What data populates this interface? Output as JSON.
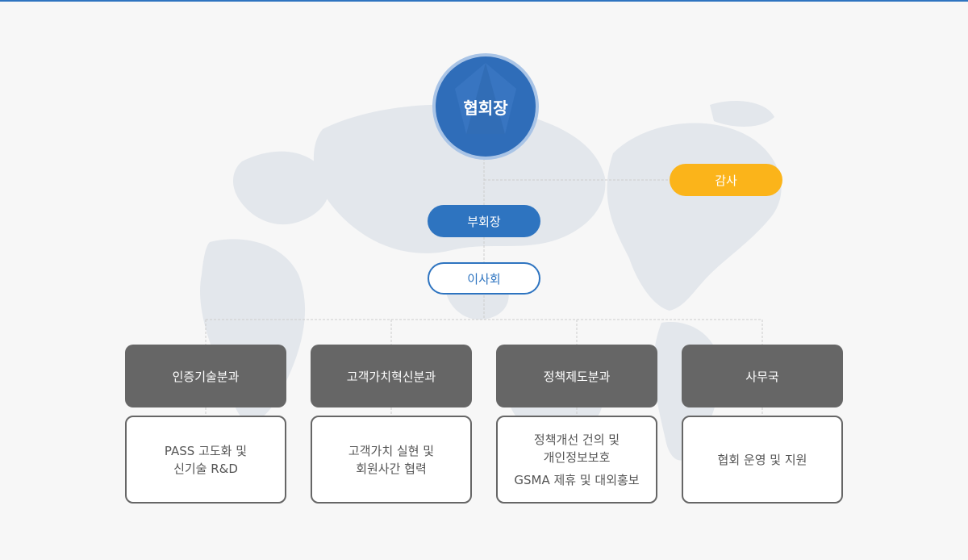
{
  "org": {
    "chairman": "협회장",
    "audit": "감사",
    "vice_chairman": "부회장",
    "board": "이사회",
    "departments": [
      {
        "name": "인증기술분과",
        "duties": [
          "PASS 고도화 및",
          "신기술 R&D"
        ]
      },
      {
        "name": "고객가치혁신분과",
        "duties": [
          "고객가치 실현 및",
          "회원사간 협력"
        ]
      },
      {
        "name": "정책제도분과",
        "duties": [
          "정책개선 건의 및",
          "개인정보보호",
          "GSMA 제휴 및 대외홍보"
        ]
      },
      {
        "name": "사무국",
        "duties": [
          "협회 운영 및 지원"
        ]
      }
    ]
  },
  "colors": {
    "chairman": "#2f6db9",
    "vice": "#2e74c0",
    "audit": "#fbb41a",
    "department": "#666666",
    "line": "#cccccc"
  }
}
